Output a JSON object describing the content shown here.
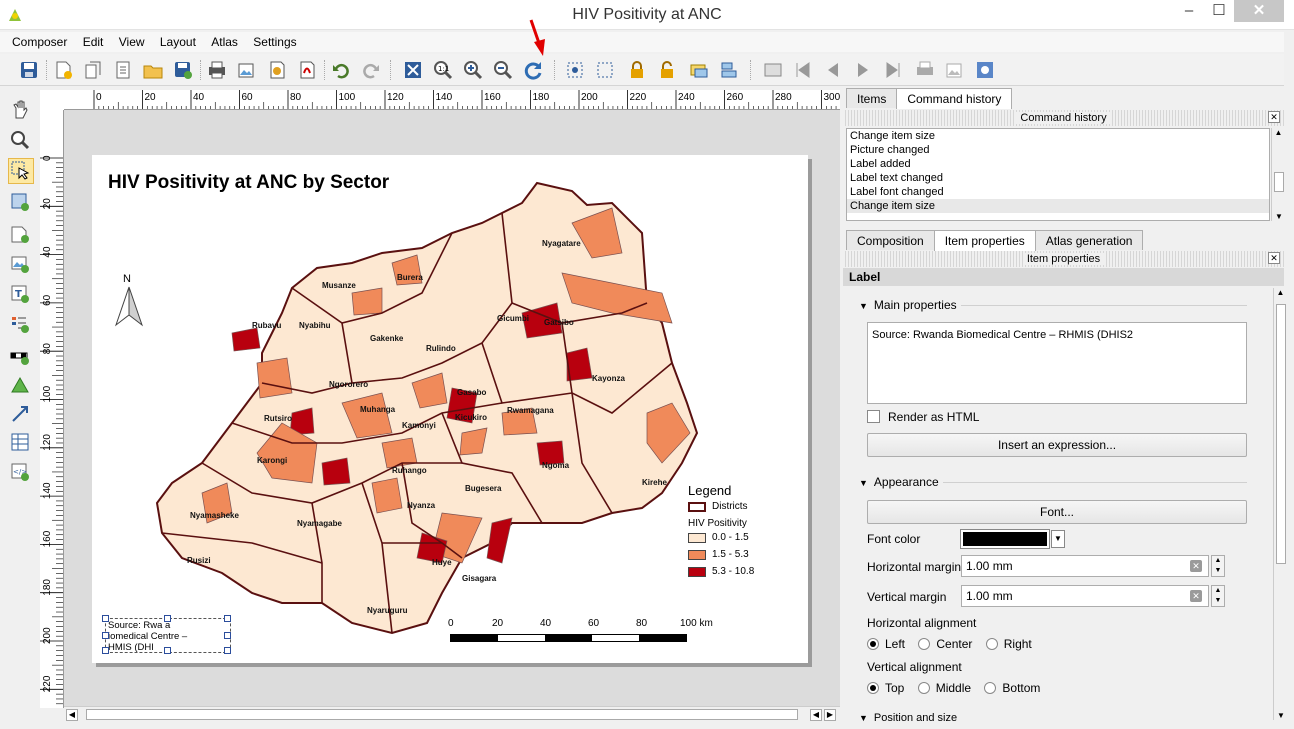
{
  "window": {
    "title": "HIV Positivity at ANC"
  },
  "menu": [
    "Composer",
    "Edit",
    "View",
    "Layout",
    "Atlas",
    "Settings"
  ],
  "ruler": {
    "top_labels": [
      "0",
      "20",
      "40",
      "60",
      "80",
      "100",
      "120",
      "140",
      "160",
      "180",
      "200",
      "220",
      "240",
      "260",
      "280",
      "300"
    ],
    "left_labels": [
      "0",
      "20",
      "40",
      "60",
      "80",
      "100",
      "120",
      "140",
      "160",
      "180",
      "200",
      "220"
    ]
  },
  "map": {
    "title": "HIV Positivity at ANC by Sector",
    "north": "N",
    "districts": [
      "Nyagatare",
      "Burera",
      "Musanze",
      "Gicumbi",
      "Gatsibo",
      "Rubavu",
      "Nyabihu",
      "Gakenke",
      "Rulindo",
      "Kayonza",
      "Ngororero",
      "Rutsiro",
      "Muhanga",
      "Gasabo",
      "Rwamagana",
      "Kamonyi",
      "Kicukiro",
      "Karongi",
      "Ruhango",
      "Ngoma",
      "Kirehe",
      "Bugesera",
      "Nyamasheke",
      "Nyamagabe",
      "Nyanza",
      "Rusizi",
      "Huye",
      "Gisagara",
      "Nyaruguru"
    ],
    "legend": {
      "title": "Legend",
      "districts_label": "Districts",
      "subtitle": "HIV Positivity",
      "classes": [
        {
          "label": "0.0 - 1.5",
          "color": "#fde8d2"
        },
        {
          "label": "1.5 - 5.3",
          "color": "#f08a5a"
        },
        {
          "label": "5.3 - 10.8",
          "color": "#b8000e"
        }
      ]
    },
    "scale": {
      "ticks": [
        "0",
        "20",
        "40",
        "60",
        "80",
        "100 km"
      ]
    },
    "source_box": [
      "Source: Rwa   a",
      "iomedical Centre –",
      "HMIS (DHI"
    ]
  },
  "dock": {
    "top_tabs": [
      "Items",
      "Command history"
    ],
    "history_header": "Command history",
    "history": [
      "Change item size",
      "Picture changed",
      "Label added",
      "Label text changed",
      "Label font changed",
      "Change item size"
    ],
    "mid_tabs": [
      "Composition",
      "Item properties",
      "Atlas generation"
    ],
    "props_header": "Item properties",
    "label_section": "Label",
    "main_props": "Main properties",
    "label_text": "Source: Rwanda Biomedical Centre – RHMIS (DHIS2",
    "render_html": "Render as HTML",
    "insert_expr": "Insert an expression...",
    "appearance": "Appearance",
    "font_btn": "Font...",
    "font_color": "Font color",
    "h_margin_label": "Horizontal margin",
    "h_margin_value": "1.00 mm",
    "v_margin_label": "Vertical margin",
    "v_margin_value": "1.00 mm",
    "h_align_label": "Horizontal alignment",
    "h_align": [
      "Left",
      "Center",
      "Right"
    ],
    "v_align_label": "Vertical alignment",
    "v_align": [
      "Top",
      "Middle",
      "Bottom"
    ],
    "position_section": "Position and size"
  },
  "colors": {
    "accent_arrow": "#e00000",
    "selected_tool": "#fde9a3"
  }
}
